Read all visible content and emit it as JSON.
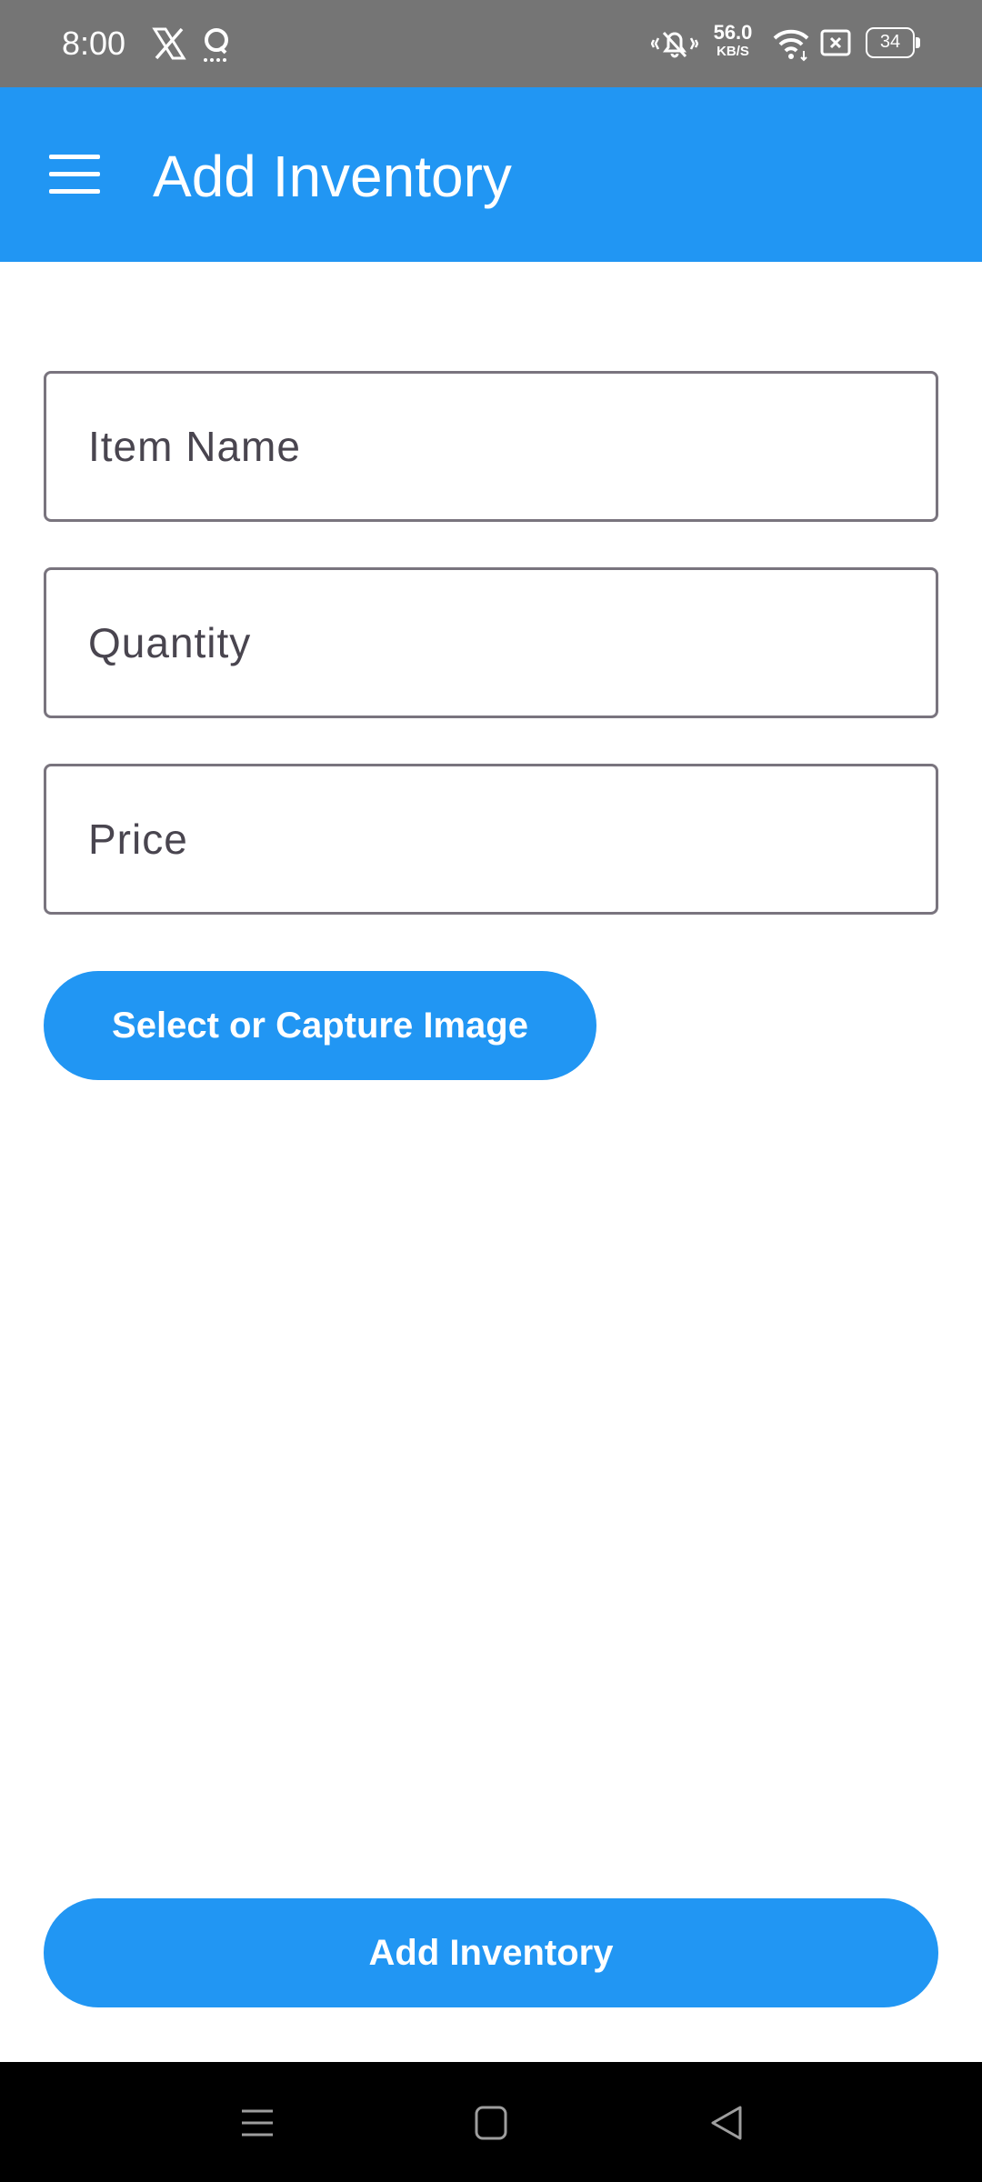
{
  "status_bar": {
    "time": "8:00",
    "net_speed_value": "56.0",
    "net_speed_unit": "KB/S",
    "battery_level": "34",
    "icons": [
      "x-app-icon",
      "q-app-icon",
      "vibrate-icon",
      "wifi-icon",
      "sim-icon",
      "battery-icon"
    ]
  },
  "app_bar": {
    "title": "Add Inventory",
    "menu_icon": "hamburger-menu-icon",
    "color": "#2196f3"
  },
  "form": {
    "item_name": {
      "placeholder": "Item Name",
      "value": ""
    },
    "quantity": {
      "placeholder": "Quantity",
      "value": ""
    },
    "price": {
      "placeholder": "Price",
      "value": ""
    }
  },
  "buttons": {
    "select_image": "Select or Capture Image",
    "add_inventory": "Add Inventory"
  },
  "nav_bar": {
    "icons": [
      "recents-icon",
      "home-icon",
      "back-icon"
    ]
  }
}
